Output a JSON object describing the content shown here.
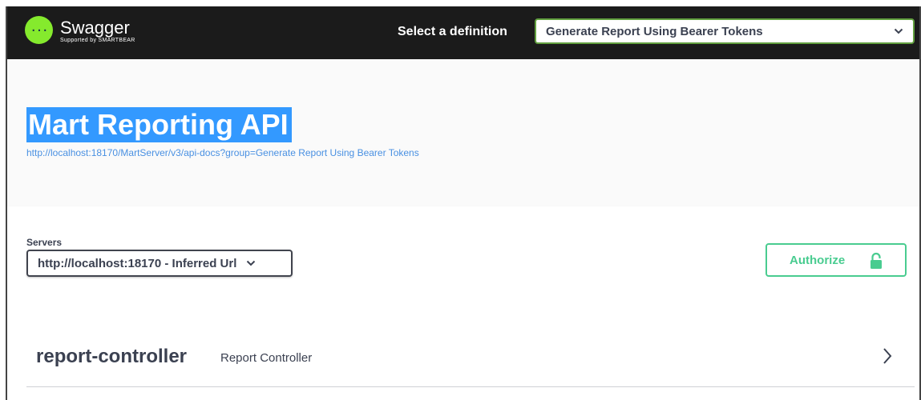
{
  "topbar": {
    "logo_title": "Swagger",
    "logo_subtitle": "Supported by SMARTBEAR",
    "definition_label": "Select a definition",
    "definition_value": "Generate Report Using Bearer Tokens",
    "accent": "#85ea2d"
  },
  "info": {
    "title": "Mart Reporting API",
    "url": "http://localhost:18170/MartServer/v3/api-docs?group=Generate Report Using Bearer Tokens",
    "title_highlight": "#3399ff"
  },
  "servers": {
    "label": "Servers",
    "selected": "http://localhost:18170 - Inferred Url"
  },
  "authorize": {
    "label": "Authorize",
    "icon": "lock-icon",
    "color": "#49cc90"
  },
  "tag": {
    "name": "report-controller",
    "description": "Report Controller",
    "icon": "chevron-right-icon"
  }
}
